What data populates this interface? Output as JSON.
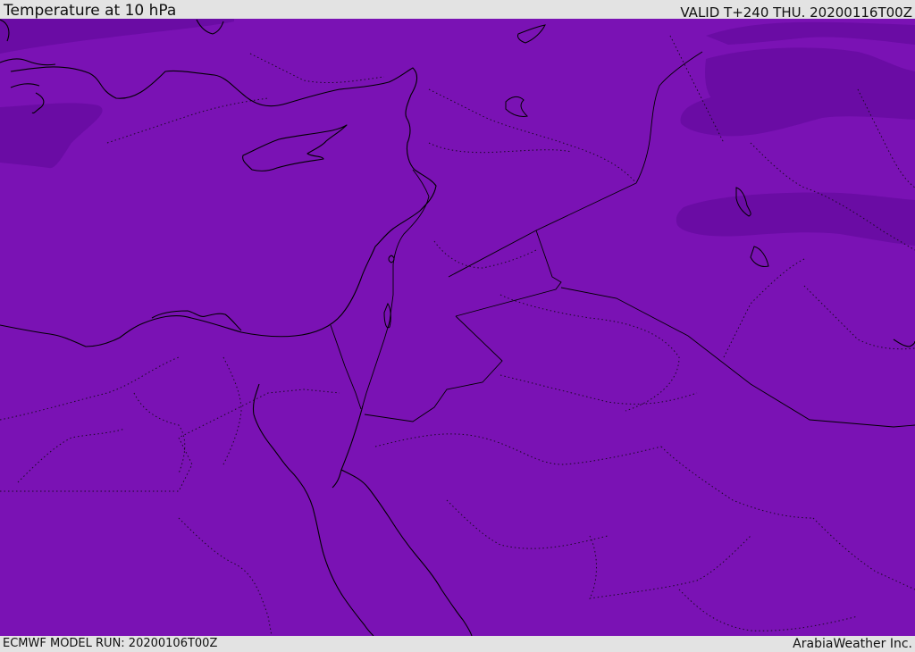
{
  "header": {
    "title": "Temperature at 10 hPa",
    "valid": "VALID T+240 THU. 20200116T00Z"
  },
  "footer": {
    "model_run": "ECMWF MODEL RUN: 20200106T00Z",
    "credit": "ArabiaWeather Inc."
  },
  "map": {
    "fill_color": "#7a12b4",
    "cold_band_color": "#6a0ca4",
    "coastline_color": "#000000"
  }
}
